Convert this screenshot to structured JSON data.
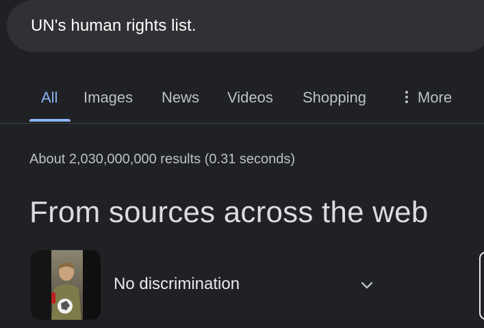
{
  "search": {
    "query": "UN's human rights list."
  },
  "tabs": [
    {
      "label": "All",
      "active": true
    },
    {
      "label": "Images",
      "active": false
    },
    {
      "label": "News",
      "active": false
    },
    {
      "label": "Videos",
      "active": false
    },
    {
      "label": "Shopping",
      "active": false
    },
    {
      "label": "More",
      "active": false,
      "icon": "vertical-dots-icon"
    }
  ],
  "results": {
    "stats": "About 2,030,000,000 results (0.31 seconds)"
  },
  "section": {
    "heading": "From sources across the web",
    "items": [
      {
        "title": "No discrimination",
        "icon": "chevron-down-icon"
      }
    ]
  },
  "colors": {
    "background": "#202124",
    "search_bar": "#303134",
    "accent": "#8ab4f8",
    "text_secondary": "#bdc1c6"
  }
}
